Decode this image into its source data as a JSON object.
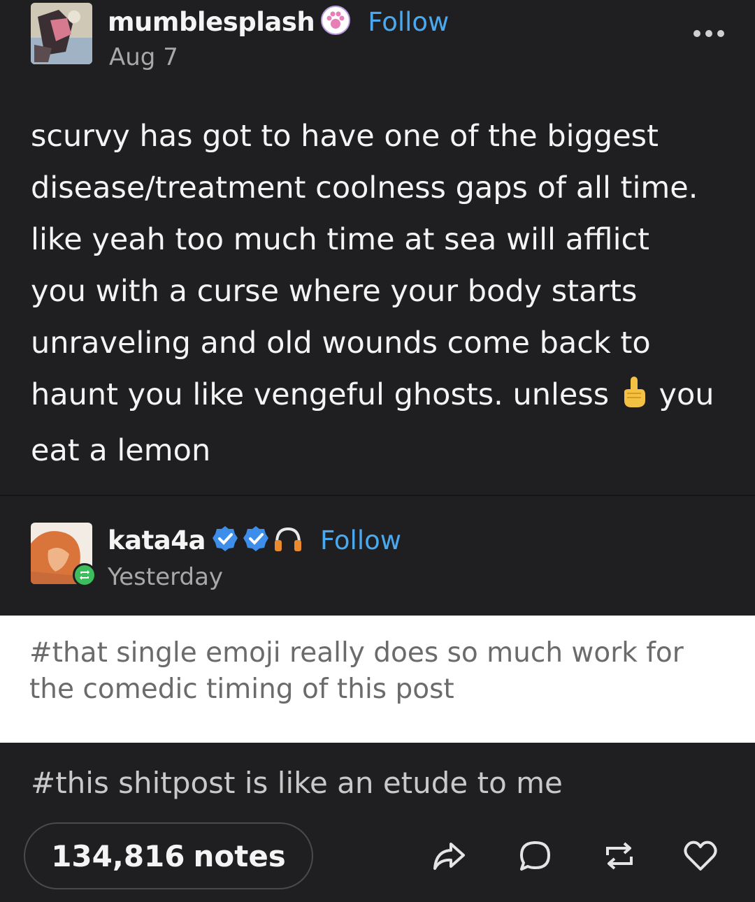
{
  "original_post": {
    "username": "mumblesplash",
    "follow_label": "Follow",
    "date": "Aug 7",
    "body_lines": [
      "scurvy has got to have one of the biggest",
      "disease/treatment coolness gaps of all time.",
      "like yeah too much time at sea will afflict",
      "you with a curse where your body starts",
      "unraveling and old wounds come back to"
    ],
    "body_line6_before": "haunt you like vengeful ghosts. unless",
    "body_line6_after": "you",
    "body_line7": "eat a lemon"
  },
  "reblog": {
    "username": "kata4a",
    "follow_label": "Follow",
    "date": "Yesterday"
  },
  "tags": {
    "tag1": "#that single emoji really does so much work for the comedic timing of this post",
    "tag2": "#this shitpost is like an etude to me"
  },
  "footer": {
    "notes_count": "134,816",
    "notes_label": "notes"
  },
  "colors": {
    "background": "#1f1f21",
    "accent": "#4aa8ef",
    "reblog_green": "#3dbd5b"
  },
  "icons": [
    "more-icon",
    "paw-badge-icon",
    "verified-icon",
    "headphones-icon",
    "reblog-badge-icon",
    "share-icon",
    "reply-icon",
    "reblog-icon",
    "like-icon"
  ]
}
